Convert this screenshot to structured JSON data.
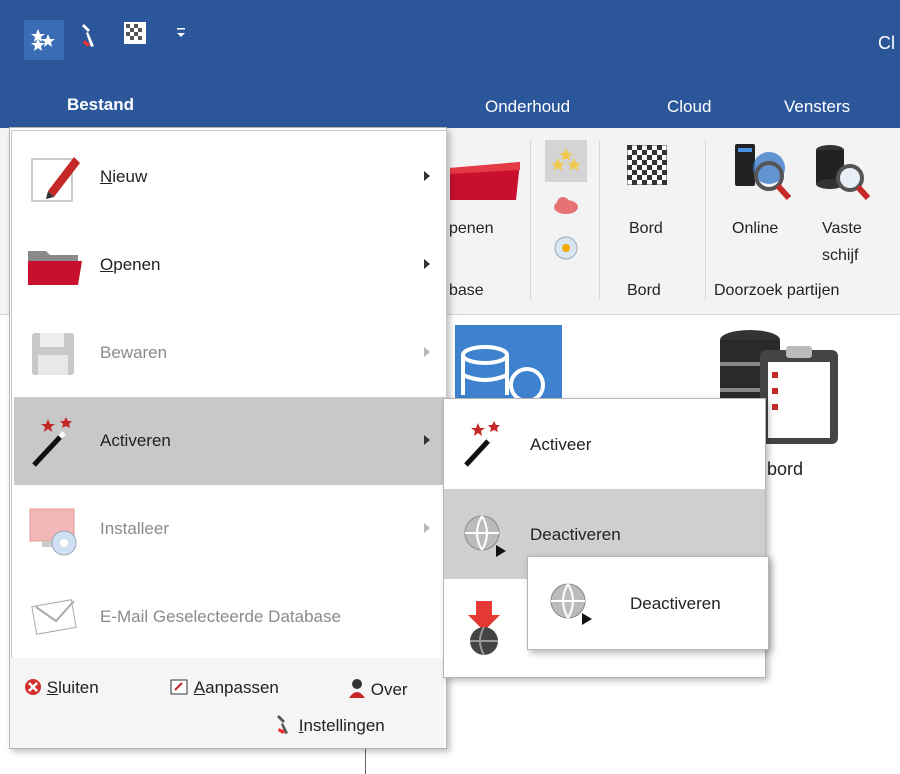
{
  "titlebar": {
    "title_fragment": "Cl"
  },
  "tabs": [
    "Onderhoud",
    "Cloud",
    "Vensters"
  ],
  "bestand_tab": "Bestand",
  "ribbon": {
    "openen_label": "penen",
    "database_group": "base",
    "bord_label": "Bord",
    "bord_group": "Bord",
    "online_label": "Online",
    "vaste_label_1": "Vaste",
    "vaste_label_2": "schijf",
    "doorzoek_group": "Doorzoek partijen"
  },
  "background": {
    "bord_fragment": ":bord"
  },
  "menu": {
    "items": [
      {
        "label": "Nieuw",
        "underline": "N",
        "rest": "ieuw",
        "enabled": true
      },
      {
        "label": "Openen",
        "underline": "O",
        "rest": "penen",
        "enabled": true
      },
      {
        "label": "Bewaren",
        "enabled": false
      },
      {
        "label": "Activeren",
        "enabled": true
      },
      {
        "label": "Installeer",
        "enabled": false
      },
      {
        "label": "E-Mail Geselecteerde Database",
        "enabled": false
      }
    ],
    "footer": {
      "sluiten_u": "S",
      "sluiten_rest": "luiten",
      "aanpassen_u": "A",
      "aanpassen_rest": "anpassen",
      "over": "Over",
      "instellingen_u": "I",
      "instellingen_rest": "nstellingen"
    }
  },
  "submenu": {
    "activeer": "Activeer",
    "deactiveren": "Deactiveren"
  },
  "flyout": {
    "deactiveren": "Deactiveren"
  },
  "colors": {
    "titlebar": "#2b579a",
    "menu_active": "#c8c8c8",
    "disabled_text": "#8a8a8a"
  }
}
